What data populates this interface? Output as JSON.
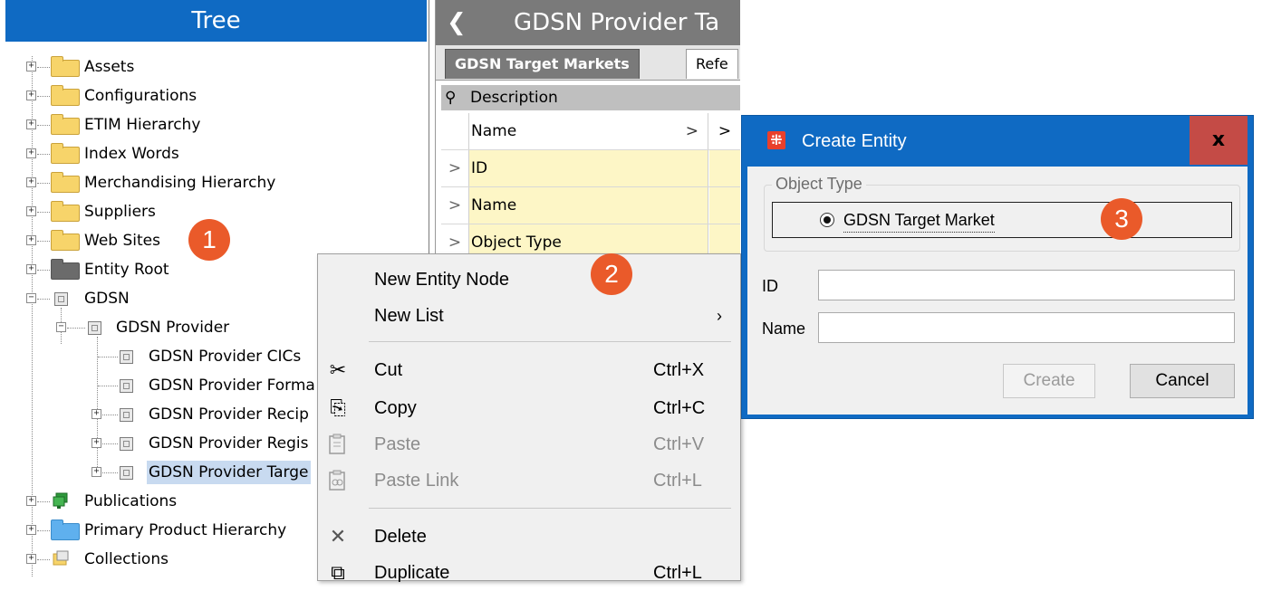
{
  "tree": {
    "title": "Tree",
    "items": [
      {
        "label": "Assets"
      },
      {
        "label": "Configurations"
      },
      {
        "label": "ETIM Hierarchy"
      },
      {
        "label": "Index Words"
      },
      {
        "label": "Merchandising Hierarchy"
      },
      {
        "label": "Suppliers"
      },
      {
        "label": "Web Sites"
      },
      {
        "label": "Entity Root"
      },
      {
        "label": "GDSN"
      },
      {
        "label": "GDSN Provider"
      },
      {
        "label": "GDSN Provider CICs"
      },
      {
        "label": "GDSN Provider Forma"
      },
      {
        "label": "GDSN Provider Recip"
      },
      {
        "label": "GDSN Provider Regis"
      },
      {
        "label": "GDSN Provider Targe"
      },
      {
        "label": "Publications"
      },
      {
        "label": "Primary Product Hierarchy"
      },
      {
        "label": "Collections"
      }
    ],
    "expand_plus": "+",
    "expand_minus": "−"
  },
  "badges": {
    "one": "1",
    "two": "2",
    "three": "3"
  },
  "editor": {
    "back_icon": "❮",
    "title": "GDSN Provider Ta",
    "tabs": [
      {
        "label": "GDSN Target Markets"
      },
      {
        "label": "Refe"
      }
    ],
    "description_label": "Description",
    "pin_icon": "pin-icon",
    "pin_glyph": "⚲",
    "rows": [
      {
        "gutter": "",
        "label": "Name",
        "chevron": ">",
        "cell2": ">"
      },
      {
        "gutter": ">",
        "label": "ID",
        "chevron": "",
        "cell2": ""
      },
      {
        "gutter": ">",
        "label": "Name",
        "chevron": "",
        "cell2": ""
      },
      {
        "gutter": ">",
        "label": "Object Type",
        "chevron": "",
        "cell2": ""
      }
    ]
  },
  "context_menu": {
    "items": [
      {
        "label": "New Entity Node",
        "shortcut": "",
        "arrow": "",
        "icon": "",
        "icon_name": ""
      },
      {
        "label": "New List",
        "shortcut": "",
        "arrow": "›",
        "icon": "",
        "icon_name": ""
      },
      {
        "label": "Cut",
        "shortcut": "Ctrl+X",
        "arrow": "",
        "icon": "✂",
        "icon_name": "scissors-icon"
      },
      {
        "label": "Copy",
        "shortcut": "Ctrl+C",
        "arrow": "",
        "icon": "⎘",
        "icon_name": "copy-icon"
      },
      {
        "label": "Paste",
        "shortcut": "Ctrl+V",
        "arrow": "",
        "icon": "📋",
        "icon_name": "paste-icon"
      },
      {
        "label": "Paste Link",
        "shortcut": "Ctrl+L",
        "arrow": "",
        "icon": "🔗",
        "icon_name": "paste-link-icon"
      },
      {
        "label": "Delete",
        "shortcut": "",
        "arrow": "",
        "icon": "✕",
        "icon_name": "delete-icon"
      },
      {
        "label": "Duplicate",
        "shortcut": "Ctrl+L",
        "arrow": "",
        "icon": "⧉",
        "icon_name": "duplicate-icon"
      }
    ]
  },
  "dialog": {
    "app_icon_glyph": "⁜",
    "title": "Create Entity",
    "close_glyph": "x",
    "object_type_legend": "Object Type",
    "object_type_value": "GDSN Target Market",
    "id_label": "ID",
    "id_value": "",
    "name_label": "Name",
    "name_value": "",
    "create_label": "Create",
    "cancel_label": "Cancel"
  }
}
